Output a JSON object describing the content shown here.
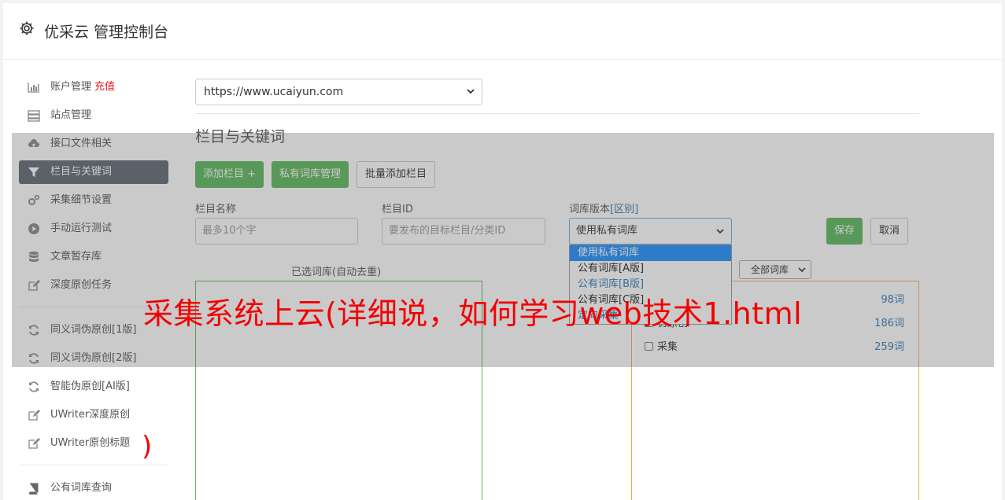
{
  "header": {
    "title": "优采云 管理控制台",
    "icon": "gear-icon"
  },
  "sidebar": {
    "items": [
      {
        "label": "账户管理",
        "badge": "充值",
        "icon": "bar-chart-icon"
      },
      {
        "label": "站点管理",
        "icon": "server-icon"
      },
      {
        "label": "接口文件相关",
        "icon": "cloud-upload-icon"
      },
      {
        "label": "栏目与关键词",
        "icon": "filter-icon",
        "active": true
      },
      {
        "label": "采集细节设置",
        "icon": "gears-icon"
      },
      {
        "label": "手动运行测试",
        "icon": "play-circle-icon"
      },
      {
        "label": "文章暂存库",
        "icon": "database-icon"
      },
      {
        "label": "深度原创任务",
        "icon": "edit-icon"
      }
    ],
    "items2": [
      {
        "label": "同义词伪原创[1版]",
        "icon": "refresh-icon"
      },
      {
        "label": "同义词伪原创[2版]",
        "icon": "refresh-icon"
      },
      {
        "label": "智能伪原创[AI版]",
        "icon": "refresh-icon"
      },
      {
        "label": "UWriter深度原创",
        "icon": "edit-icon"
      },
      {
        "label": "UWriter原创标题",
        "icon": "edit-icon"
      }
    ],
    "items3": [
      {
        "label": "公有词库查询",
        "icon": "book-icon"
      }
    ]
  },
  "main": {
    "site_select": "https://www.ucaiyun.com",
    "section_title": "栏目与关键词",
    "buttons": {
      "add": "添加栏目 +",
      "private": "私有词库管理",
      "batch": "批量添加栏目",
      "save": "保存",
      "cancel": "取消"
    },
    "form": {
      "name_label": "栏目名称",
      "name_placeholder": "最多10个字",
      "id_label": "栏目ID",
      "id_placeholder": "要发布的目标栏目/分类ID",
      "version_label": "词库版本",
      "version_diff": "[区别]",
      "version_value": "使用私有词库"
    },
    "dropdown_options": [
      "使用私有词库",
      "公有词库[A版]",
      "公有词库[B版]",
      "公有词库[C版]",
      "定向采集"
    ],
    "selected_label": "已选词库(自动去重)",
    "filter_value": "全部词库",
    "libraries": [
      {
        "name": "",
        "count": "98词"
      },
      {
        "name": "伪原创",
        "count": "186词"
      },
      {
        "name": "采集",
        "count": "259词"
      }
    ]
  },
  "watermark": "采集系统上云(详细说，如何学习web技术1.html",
  "watermark_paren": ")",
  "colors": {
    "active_nav": "#616975",
    "green": "#5cb85c",
    "orange": "#f0ad4e",
    "red": "#f20000",
    "link": "#337ab7"
  }
}
